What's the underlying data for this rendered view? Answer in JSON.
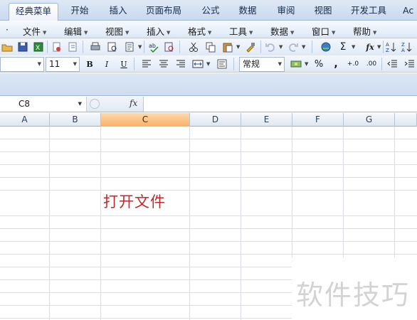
{
  "ribbon_tabs": [
    "经典菜单",
    "开始",
    "插入",
    "页面布局",
    "公式",
    "数据",
    "审阅",
    "视图",
    "开发工具",
    "Ac"
  ],
  "menu": [
    "文件",
    "编辑",
    "视图",
    "插入",
    "格式",
    "工具",
    "数据",
    "窗口",
    "帮助"
  ],
  "toolbar": {
    "font_size": "11",
    "font_name": "",
    "bold": "B",
    "italic": "I",
    "underline": "U",
    "number_format": "常规",
    "percent": "%",
    "comma": ",",
    "increase_decimal": "+.0",
    "decrease_decimal": ".00",
    "sum": "Σ",
    "fx": "fx"
  },
  "formula_bar": {
    "name_box": "C8",
    "fx_label": "fx",
    "content": ""
  },
  "columns": [
    "A",
    "B",
    "C",
    "D",
    "E",
    "F",
    "G"
  ],
  "selected_column": "C",
  "cell_content": "打开文件",
  "watermark": "软件技巧",
  "colors": {
    "ribbon_bg": "#c9d9ee",
    "selected_header": "#f8b06a",
    "cell_text": "#c0282a",
    "watermark": "#d3d3d3"
  }
}
